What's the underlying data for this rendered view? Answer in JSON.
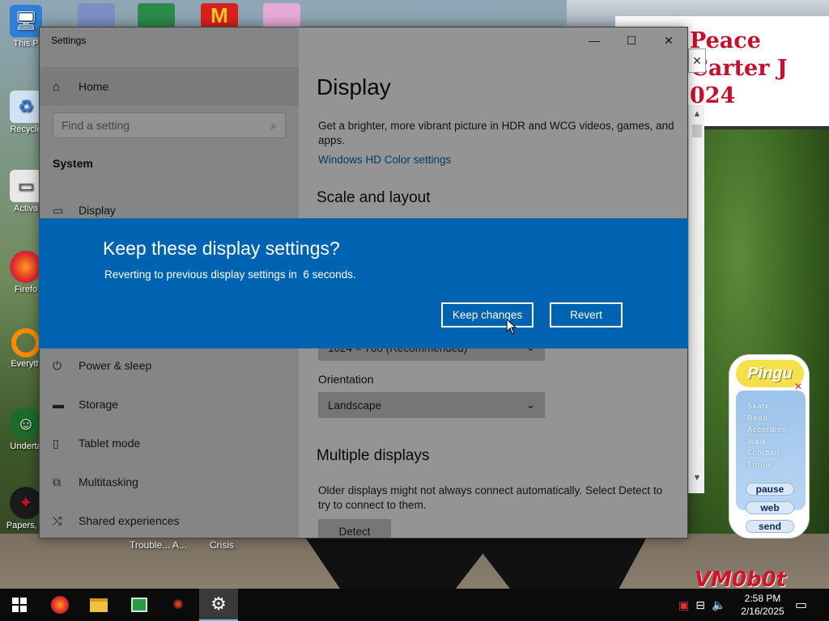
{
  "window": {
    "title": "Settings",
    "controls": {
      "minimize": "—",
      "maximize": "☐",
      "close": "✕"
    }
  },
  "sidebar": {
    "home": "Home",
    "search_placeholder": "Find a setting",
    "section": "System",
    "items": [
      {
        "label": "Display",
        "icon": "monitor-icon"
      },
      {
        "label": "Power & sleep",
        "icon": "power-icon"
      },
      {
        "label": "Storage",
        "icon": "storage-icon"
      },
      {
        "label": "Tablet mode",
        "icon": "tablet-icon"
      },
      {
        "label": "Multitasking",
        "icon": "multitasking-icon"
      },
      {
        "label": "Shared experiences",
        "icon": "shared-icon"
      }
    ]
  },
  "content": {
    "title": "Display",
    "hdr_text": "Get a brighter, more vibrant picture in HDR and WCG videos, games, and apps.",
    "hdr_link": "Windows HD Color settings",
    "scale_heading": "Scale and layout",
    "resolution_value": "1024 × 768 (Recommended)",
    "orientation_label": "Orientation",
    "orientation_value": "Landscape",
    "multiple_heading": "Multiple displays",
    "multiple_text": "Older displays might not always connect automatically. Select Detect to try to connect to them.",
    "detect_label": "Detect"
  },
  "dialog": {
    "title": "Keep these display settings?",
    "message": "Reverting to previous display settings in  6 seconds.",
    "keep_label": "Keep changes",
    "revert_label": "Revert",
    "accent": "#0063b1"
  },
  "desktop": {
    "icons": [
      {
        "label": "This P",
        "icon": "computer-icon"
      },
      {
        "label": "Recycle",
        "icon": "recycle-bin-icon"
      },
      {
        "label": "Activa",
        "icon": "activate-icon"
      },
      {
        "label": "Firefo",
        "icon": "firefox-icon"
      },
      {
        "label": "Everyth",
        "icon": "everything-icon"
      },
      {
        "label": "Underta",
        "icon": "undertale-icon"
      },
      {
        "label": "Papers, P",
        "icon": "papers-please-icon"
      }
    ],
    "extra_labels": [
      "Trouble... A...",
      "Crisis"
    ],
    "sign_lines": [
      "Peace",
      "arl Carter J",
      "024"
    ],
    "watermark": "VM0b0t"
  },
  "pingu": {
    "logo": "Pingu",
    "menu": [
      "Skate",
      "Read",
      "Accordion",
      "Walk",
      "Football",
      "Throw"
    ],
    "buttons": [
      "pause",
      "web",
      "send"
    ]
  },
  "taskbar": {
    "time": "2:58 PM",
    "date": "2/16/2025",
    "apps": [
      "windows-start-icon",
      "firefox-icon",
      "file-explorer-icon",
      "task-manager-icon",
      "crab-icon",
      "settings-gear-icon"
    ]
  }
}
